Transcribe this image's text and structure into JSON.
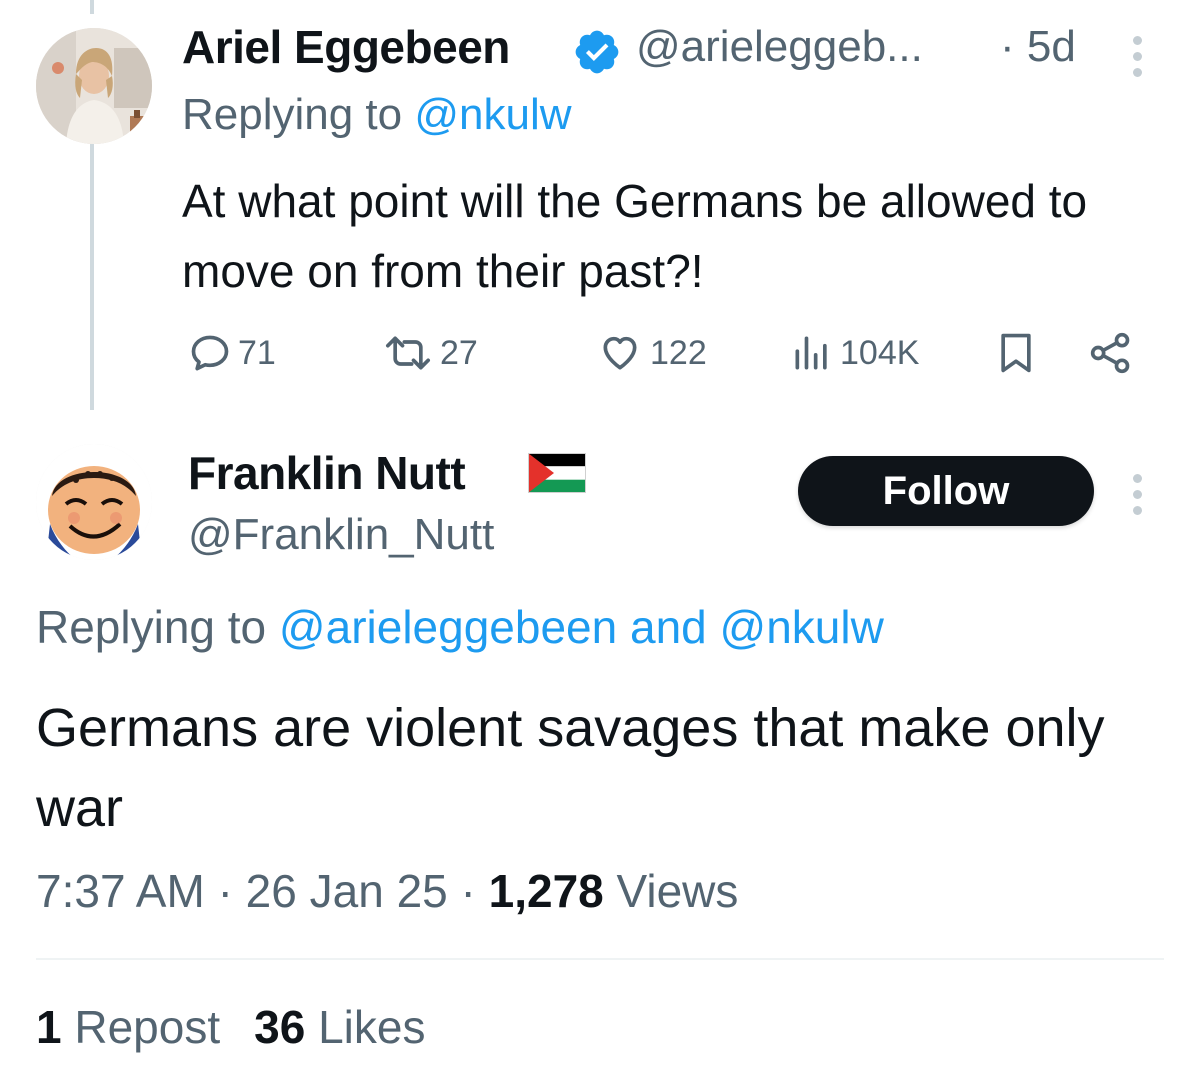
{
  "tweet1": {
    "name": "Ariel Eggebeen",
    "handle": "@arieleggeb...",
    "time": "· 5d",
    "reply_prefix": "Replying to ",
    "reply_mention": "@nkulw",
    "text": "At what point will the Germans be allowed to move on from their past?!",
    "actions": {
      "replies": "71",
      "reposts": "27",
      "likes": "122",
      "views": "104K"
    }
  },
  "tweet2": {
    "name": "Franklin Nutt",
    "handle": "@Franklin_Nutt",
    "follow_label": "Follow",
    "reply_prefix": "Replying to ",
    "reply_mentions": "@arieleggebeen and @nkulw",
    "text": "Germans are violent savages that make only war",
    "time": "7:37 AM",
    "date": "26 Jan 25",
    "views_count": "1,278",
    "views_label": "Views",
    "repost_count": "1",
    "repost_label": "Repost",
    "likes_count": "36",
    "likes_label": "Likes"
  },
  "colors": {
    "text_primary": "#0f1419",
    "text_secondary": "#536471",
    "link": "#1d9bf0",
    "verified": "#1d9bf0",
    "button_bg": "#0f1419",
    "thread_line": "#cfd9de"
  },
  "icons": {
    "verified": "verified-badge-icon",
    "reply": "speech-bubble-icon",
    "repost": "repost-arrows-icon",
    "like": "heart-icon",
    "views": "bar-chart-icon",
    "bookmark": "bookmark-icon",
    "share": "share-nodes-icon",
    "more": "more-vertical-icon",
    "flag": "palestine-flag-icon"
  }
}
